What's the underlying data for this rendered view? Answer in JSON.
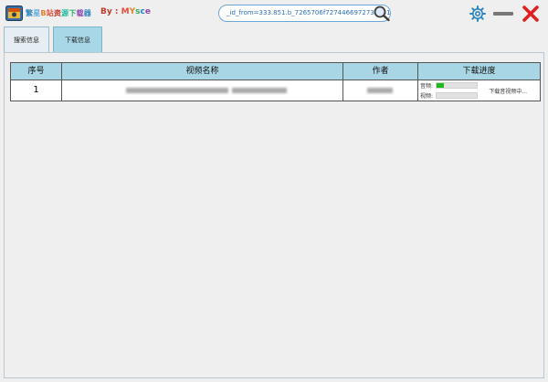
{
  "app": {
    "title": "繁星B站资源下载器",
    "title_colors": [
      "#2e86c1",
      "#5dade2",
      "#e67e22",
      "#e74c3c",
      "#c0392b",
      "#1abc9c",
      "#27ae60",
      "#8e44ad"
    ],
    "by_label": "By : MYsce"
  },
  "url_bar": {
    "value": "_id_from=333.851.b_7265706f7274466972737431.7"
  },
  "icons": {
    "logo": "film-logo-icon",
    "search": "search-icon",
    "settings": "gear-icon",
    "minimize": "minimize-icon",
    "close": "close-icon"
  },
  "tabs": [
    {
      "label": "搜索信息",
      "active": false
    },
    {
      "label": "下载信息",
      "active": true
    }
  ],
  "table": {
    "headers": [
      "序号",
      "视频名称",
      "作者",
      "下载进度"
    ],
    "rows": [
      {
        "index": "1",
        "name_redacted": true,
        "author_redacted": true,
        "audio_label": "音频:",
        "video_label": "视频:",
        "audio_progress": 0.18,
        "video_progress": 0.0,
        "status": "下载音视频中..."
      }
    ]
  },
  "colors": {
    "header_bg": "#a9d6e5",
    "active_tab": "#a8d8e8",
    "progress_fill": "#1fb81f",
    "close_red": "#e02020",
    "settings_blue": "#2e86c1"
  }
}
